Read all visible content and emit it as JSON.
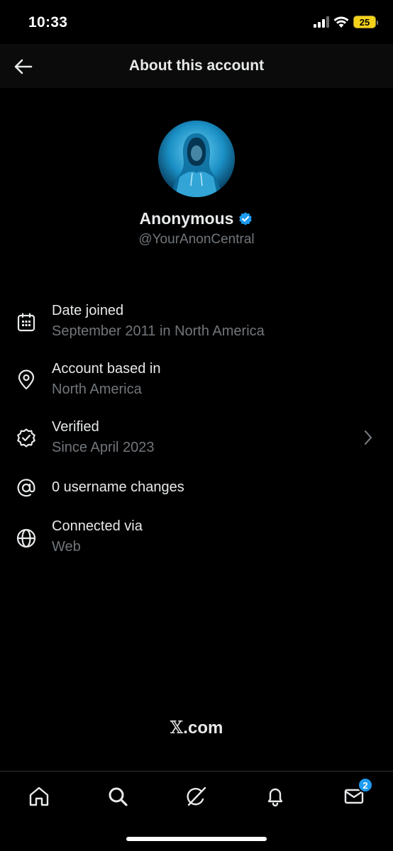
{
  "status_bar": {
    "time": "10:33",
    "battery_level": "25"
  },
  "header": {
    "title": "About this account"
  },
  "profile": {
    "display_name": "Anonymous",
    "handle": "@YourAnonCentral",
    "verified": true
  },
  "info_items": [
    {
      "icon": "calendar-icon",
      "title": "Date joined",
      "subtitle": "September 2011 in North America"
    },
    {
      "icon": "location-pin-icon",
      "title": "Account based in",
      "subtitle": "North America"
    },
    {
      "icon": "verified-badge-icon",
      "title": "Verified",
      "subtitle": "Since April 2023"
    },
    {
      "icon": "at-sign-icon",
      "title": "0 username changes"
    },
    {
      "icon": "globe-icon",
      "title": "Connected via",
      "subtitle": "Web"
    }
  ],
  "footer": {
    "logo_mark": "𝕏",
    "logo_suffix": ".com"
  },
  "tab_bar": {
    "messages_badge": "2"
  },
  "colors": {
    "background": "#000000",
    "primary_text": "#e7e9ea",
    "secondary_text": "#71767b",
    "accent": "#1d9bf0",
    "battery": "#f5d21a"
  }
}
